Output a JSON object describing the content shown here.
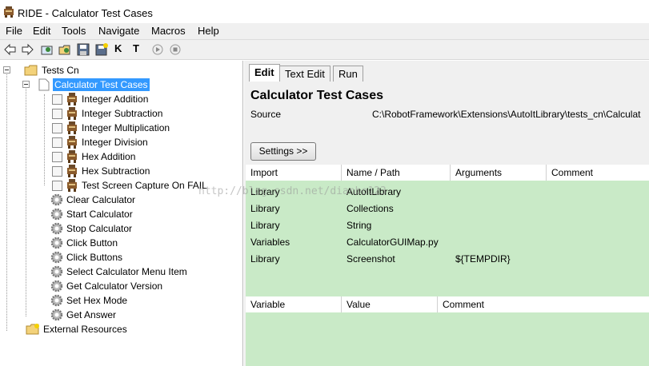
{
  "window": {
    "title": "RIDE - Calculator Test Cases"
  },
  "menu": [
    "File",
    "Edit",
    "Tools",
    "Navigate",
    "Macros",
    "Help"
  ],
  "toolbar": {
    "k_label": "K",
    "t_label": "T"
  },
  "tree": {
    "root": "Tests Cn",
    "suite": "Calculator Test Cases",
    "tests": [
      "Integer Addition",
      "Integer Subtraction",
      "Integer Multiplication",
      "Integer Division",
      "Hex Addition",
      "Hex Subtraction",
      "Test Screen Capture On FAIL"
    ],
    "keywords": [
      "Clear Calculator",
      "Start Calculator",
      "Stop Calculator",
      "Click Button",
      "Click Buttons",
      "Select Calculator Menu Item",
      "Get Calculator Version",
      "Set Hex Mode",
      "Get Answer"
    ],
    "external": "External Resources"
  },
  "tabs": [
    "Edit",
    "Text Edit",
    "Run"
  ],
  "editor": {
    "title": "Calculator Test Cases",
    "source_label": "Source",
    "source_path": "C:\\RobotFramework\\Extensions\\AutoItLibrary\\tests_cn\\Calculat",
    "settings_button": "Settings >>",
    "import_headers": [
      "Import",
      "Name / Path",
      "Arguments",
      "Comment"
    ],
    "imports": [
      {
        "type": "Library",
        "name": "AutoItLibrary",
        "args": ""
      },
      {
        "type": "Library",
        "name": "Collections",
        "args": ""
      },
      {
        "type": "Library",
        "name": "String",
        "args": ""
      },
      {
        "type": "Variables",
        "name": "CalculatorGUIMap.py",
        "args": ""
      },
      {
        "type": "Library",
        "name": "Screenshot",
        "args": "${TEMPDIR}"
      }
    ],
    "variable_headers": [
      "Variable",
      "Value",
      "Comment"
    ]
  },
  "watermark": "http://blog.csdn.net/dianbo123",
  "colors": {
    "grid_green": "#c9eac7",
    "selection": "#3399ff"
  }
}
